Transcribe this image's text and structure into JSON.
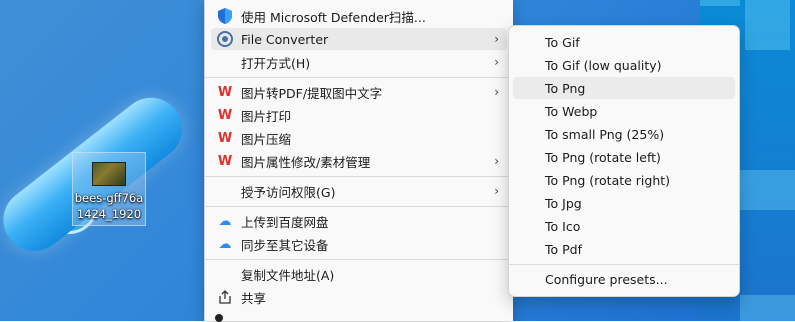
{
  "desktop_file": {
    "name_line1": "bees-gff76a",
    "name_line2": "1424_1920"
  },
  "context_menu": {
    "items": [
      {
        "label": "使用 Microsoft Defender扫描...",
        "icon": "defender-shield-icon"
      },
      {
        "label": "File Converter",
        "icon": "file-converter-icon",
        "has_submenu": true
      },
      {
        "label": "打开方式(H)",
        "has_submenu": true
      },
      {
        "label": "图片转PDF/提取图中文字",
        "icon": "wps-icon",
        "has_submenu": true
      },
      {
        "label": "图片打印",
        "icon": "wps-icon"
      },
      {
        "label": "图片压缩",
        "icon": "wps-icon"
      },
      {
        "label": "图片属性修改/素材管理",
        "icon": "wps-icon",
        "has_submenu": true
      },
      {
        "label": "授予访问权限(G)",
        "has_submenu": true
      },
      {
        "label": "上传到百度网盘",
        "icon": "baidu-netdisk-icon"
      },
      {
        "label": "同步至其它设备",
        "icon": "baidu-netdisk-icon"
      },
      {
        "label": "复制文件地址(A)"
      },
      {
        "label": "共享",
        "icon": "share-icon"
      }
    ],
    "arrow": "›",
    "wps_glyph": "W",
    "cloud_glyph": "☁"
  },
  "submenu": {
    "items": [
      "To Gif",
      "To Gif (low quality)",
      "To Png",
      "To Webp",
      "To small Png (25%)",
      "To Png (rotate left)",
      "To Png (rotate right)",
      "To Jpg",
      "To Ico",
      "To Pdf",
      "Configure presets..."
    ]
  },
  "colors": {
    "wps_red": "#e1312b",
    "cloud_blue": "#2e8cf0",
    "menu_bg": "#f9f9f9"
  }
}
